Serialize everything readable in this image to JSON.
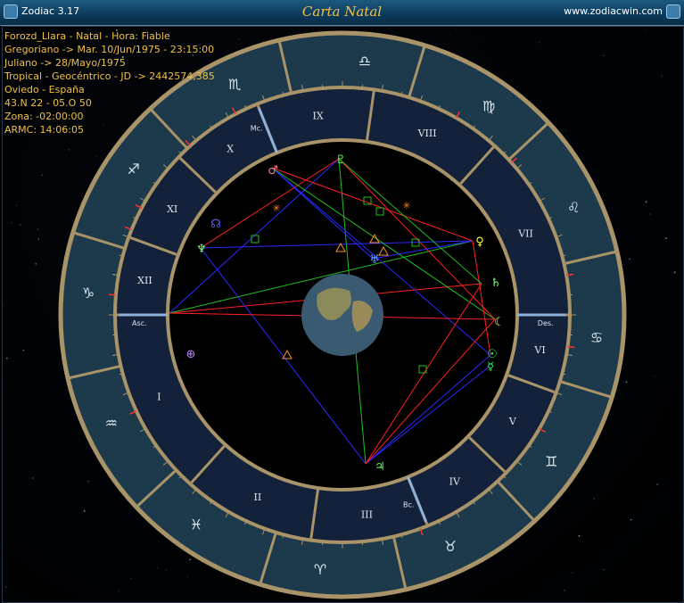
{
  "window": {
    "app_title": "Zodiac 3.17",
    "chart_title": "Carta Natal",
    "website": "www.zodiacwin.com"
  },
  "info": [
    "Forozd_Llara - Natal - Hora: Fiable",
    "Gregoriano -> Mar. 10/Jun/1975 - 23:15:00",
    "Juliano -> 28/Mayo/1975",
    "Tropical - Geocéntrico - JD -> 2442574,385",
    "Oviedo - España",
    "43.N 22 - 05.O 50",
    "Zona: -02:00:00",
    "ARMC: 14:06:05"
  ],
  "axes": {
    "asc": "Asc.",
    "des": "Des.",
    "mc": "Mc.",
    "bc": "Bc."
  },
  "signs": [
    {
      "glyph": "♎"
    },
    {
      "glyph": "♍"
    },
    {
      "glyph": "♌"
    },
    {
      "glyph": "♋"
    },
    {
      "glyph": "♊"
    },
    {
      "glyph": "♉"
    },
    {
      "glyph": "♈"
    },
    {
      "glyph": "♓"
    },
    {
      "glyph": "♒"
    },
    {
      "glyph": "♑"
    },
    {
      "glyph": "♐"
    },
    {
      "glyph": "♏"
    }
  ],
  "houses": [
    "I",
    "II",
    "III",
    "IV",
    "V",
    "VI",
    "VII",
    "VIII",
    "IX",
    "X",
    "XI",
    "XII"
  ],
  "planets": [
    {
      "name": "sun",
      "glyph": "☉"
    },
    {
      "name": "moon",
      "glyph": "☾"
    },
    {
      "name": "mercury",
      "glyph": "☿"
    },
    {
      "name": "venus",
      "glyph": "♀"
    },
    {
      "name": "mars",
      "glyph": "♂"
    },
    {
      "name": "jupiter",
      "glyph": "♃"
    },
    {
      "name": "saturn",
      "glyph": "♄"
    },
    {
      "name": "uranus",
      "glyph": "♅"
    },
    {
      "name": "neptune",
      "glyph": "♆"
    },
    {
      "name": "pluto",
      "glyph": "♇"
    },
    {
      "name": "node",
      "glyph": "☊"
    },
    {
      "name": "fortuna",
      "glyph": "⊕"
    }
  ],
  "colors": {
    "gold": "#f0c040",
    "ring": "#1c3a4c",
    "house_ring": "#13213a",
    "rim": "#a89468",
    "red": "#ff2020",
    "blue": "#2a2aff",
    "green": "#20c020"
  }
}
